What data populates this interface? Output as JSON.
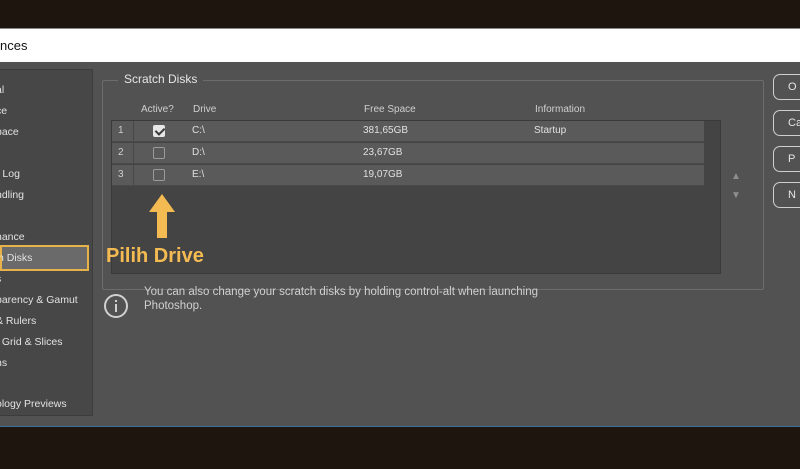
{
  "window": {
    "title": "nces"
  },
  "sidebar": {
    "items": [
      {
        "label": "al",
        "selected": false
      },
      {
        "label": "ce",
        "selected": false
      },
      {
        "label": "pace",
        "selected": false
      },
      {
        "label": "",
        "selected": false
      },
      {
        "label": "r Log",
        "selected": false
      },
      {
        "label": "ndling",
        "selected": false
      },
      {
        "label": "",
        "selected": false
      },
      {
        "label": "nance",
        "selected": false
      },
      {
        "label": "h Disks",
        "selected": true
      },
      {
        "label": "s",
        "selected": false
      },
      {
        "label": "parency & Gamut",
        "selected": false
      },
      {
        "label": "& Rulers",
        "selected": false
      },
      {
        "label": ", Grid & Slices",
        "selected": false
      },
      {
        "label": "ns",
        "selected": false
      },
      {
        "label": "",
        "selected": false
      },
      {
        "label": "ology Previews",
        "selected": false
      }
    ]
  },
  "scratch": {
    "title": "Scratch Disks",
    "columns": {
      "active": "Active?",
      "drive": "Drive",
      "free": "Free Space",
      "info": "Information"
    },
    "rows": [
      {
        "num": "1",
        "active": true,
        "drive": "C:\\",
        "free": "381,65GB",
        "info": "Startup"
      },
      {
        "num": "2",
        "active": false,
        "drive": "D:\\",
        "free": "23,67GB",
        "info": ""
      },
      {
        "num": "3",
        "active": false,
        "drive": "E:\\",
        "free": "19,07GB",
        "info": ""
      }
    ],
    "move_up": "▲",
    "move_down": "▼"
  },
  "info": {
    "line1": "You can also change your scratch disks by holding control-alt when launching",
    "line2": "Photoshop."
  },
  "buttons": {
    "ok": "O",
    "cancel": "Ca",
    "prev": "P",
    "next": "N"
  },
  "annotation": {
    "label": "Pilih Drive",
    "color": "#f4bb52"
  },
  "colors": {
    "selection_border": "#e8b24a",
    "dialog_bg": "#525252"
  }
}
